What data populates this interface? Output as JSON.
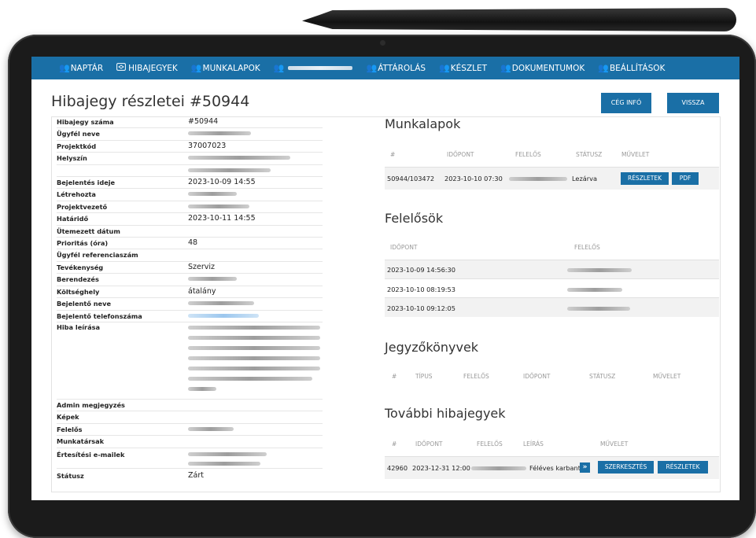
{
  "nav": {
    "items": [
      {
        "label": "NAPTÁR",
        "icon": "users-icon"
      },
      {
        "label": "HIBAJEGYEK",
        "icon": "ticket-icon"
      },
      {
        "label": "MUNKALAPOK",
        "icon": "users-icon"
      },
      {
        "label": "",
        "icon": "users-icon",
        "redacted": true
      },
      {
        "label": "ÁTTÁROLÁS",
        "icon": "users-icon"
      },
      {
        "label": "KÉSZLET",
        "icon": "users-icon"
      },
      {
        "label": "DOKUMENTUMOK",
        "icon": "users-icon"
      },
      {
        "label": "BEÁLLÍTÁSOK",
        "icon": "users-icon"
      }
    ]
  },
  "header": {
    "title": "Hibajegy részletei #50944",
    "company_btn": "CÉG INFÓ",
    "back_btn": "VISSZA"
  },
  "details": [
    {
      "label": "Hibajegy száma",
      "value": "#50944"
    },
    {
      "label": "Ügyfél neve",
      "value": ""
    },
    {
      "label": "Projektkód",
      "value": "37007023"
    },
    {
      "label": "Helyszín",
      "value": ""
    },
    {
      "label": "",
      "value": ""
    },
    {
      "label": "Bejelentés ideje",
      "value": "2023-10-09 14:55"
    },
    {
      "label": "Létrehozta",
      "value": ""
    },
    {
      "label": "Projektvezető",
      "value": ""
    },
    {
      "label": "Határidő",
      "value": "2023-10-11 14:55"
    },
    {
      "label": "Ütemezett dátum",
      "value": ""
    },
    {
      "label": "Prioritás (óra)",
      "value": "48"
    },
    {
      "label": "Ügyfél referenciaszám",
      "value": ""
    },
    {
      "label": "Tevékenység",
      "value": "Szerviz"
    },
    {
      "label": "Berendezés",
      "value": ""
    },
    {
      "label": "Költséghely",
      "value": "átalány"
    },
    {
      "label": "Bejelentő neve",
      "value": ""
    },
    {
      "label": "Bejelentő telefonszáma",
      "value": ""
    },
    {
      "label": "Hiba leírása",
      "value": ""
    },
    {
      "label": "Admin megjegyzés",
      "value": ""
    },
    {
      "label": "Képek",
      "value": ""
    },
    {
      "label": "Felelős",
      "value": ""
    },
    {
      "label": "Munkatársak",
      "value": ""
    },
    {
      "label": "Értesítési e-mailek",
      "value": ""
    },
    {
      "label": "Státusz",
      "value": "Zárt"
    }
  ],
  "worksheets": {
    "title": "Munkalapok",
    "headers": [
      "#",
      "IDŐPONT",
      "FELELŐS",
      "STÁTUSZ",
      "MŰVELET"
    ],
    "row": {
      "id": "50944/103472",
      "time": "2023-10-10 07:30",
      "status": "Lezárva",
      "details_btn": "RÉSZLETEK",
      "pdf_btn": "PDF"
    }
  },
  "responsibles": {
    "title": "Felelősök",
    "headers": [
      "IDŐPONT",
      "FELELŐS"
    ],
    "rows": [
      {
        "time": "2023-10-09 14:56:30"
      },
      {
        "time": "2023-10-10 08:19:53"
      },
      {
        "time": "2023-10-10 09:12:05"
      }
    ]
  },
  "protocols": {
    "title": "Jegyzőkönyvek",
    "headers": [
      "#",
      "TÍPUS",
      "FELELŐS",
      "IDŐPONT",
      "STÁTUSZ",
      "MŰVELET"
    ]
  },
  "more_tickets": {
    "title": "További hibajegyek",
    "headers": [
      "#",
      "IDŐPONT",
      "FELELŐS",
      "LEÍRÁS",
      "MŰVELET"
    ],
    "row": {
      "id": "42960",
      "time": "2023-12-31 12:00",
      "desc": "Féléves karbant",
      "edit_btn": "SZERKESZTÉS",
      "details_btn": "RÉSZLETEK"
    }
  }
}
